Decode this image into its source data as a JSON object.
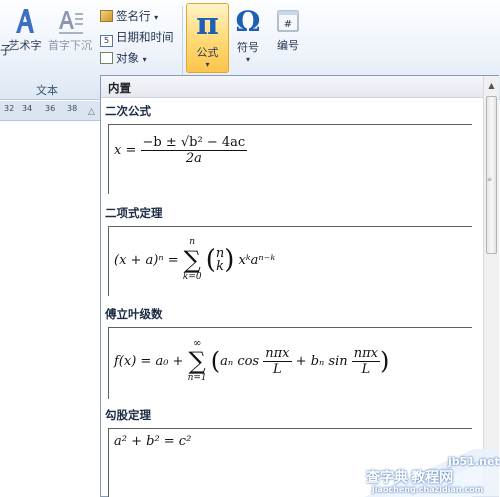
{
  "ribbon": {
    "left_cut_label": "子",
    "wordart_label": "艺术字",
    "dropcap_label": "首字下沉",
    "signature_label": "签名行",
    "datetime_label": "日期和时间",
    "object_label": "对象",
    "formula_label": "公式",
    "symbol_label": "符号",
    "number_label": "编号",
    "text_group_label": "文本"
  },
  "ruler": {
    "ticks": [
      "32",
      "34",
      "36",
      "38"
    ]
  },
  "dropdown": {
    "title": "内置",
    "sections": [
      {
        "heading": "二次公式"
      },
      {
        "heading": "二项式定理"
      },
      {
        "heading": "傅立叶级数"
      },
      {
        "heading": "勾股定理"
      }
    ]
  },
  "formulas": {
    "quadratic": {
      "lhs": "x =",
      "numerator": "−b ± √b² − 4ac",
      "denominator": "2a"
    },
    "binomial": {
      "lhs": "(x + a)ⁿ =",
      "sum_top": "n",
      "sum_bottom": "k=0",
      "sigma": "∑",
      "binom_top": "n",
      "binom_bottom": "k",
      "term": "xᵏaⁿ⁻ᵏ"
    },
    "fourier": {
      "lhs": "f(x) = a₀ +",
      "sum_top": "∞",
      "sum_bottom": "n=1",
      "sigma": "∑",
      "term1_pre": "aₙ cos",
      "frac1_num": "nπx",
      "frac1_den": "L",
      "plus": "+",
      "term2_pre": "bₙ sin",
      "frac2_num": "nπx",
      "frac2_den": "L"
    },
    "pythagorean": {
      "expr": "a² + b² = c²"
    }
  },
  "watermark": {
    "line1": "查字典",
    "line2": "教程网",
    "domain": "jb51.net",
    "url": "jiaocheng.chazidian.com"
  },
  "colors": {
    "accent_blue": "#1e5fb4",
    "formula_btn_bg": "#ffd974"
  }
}
